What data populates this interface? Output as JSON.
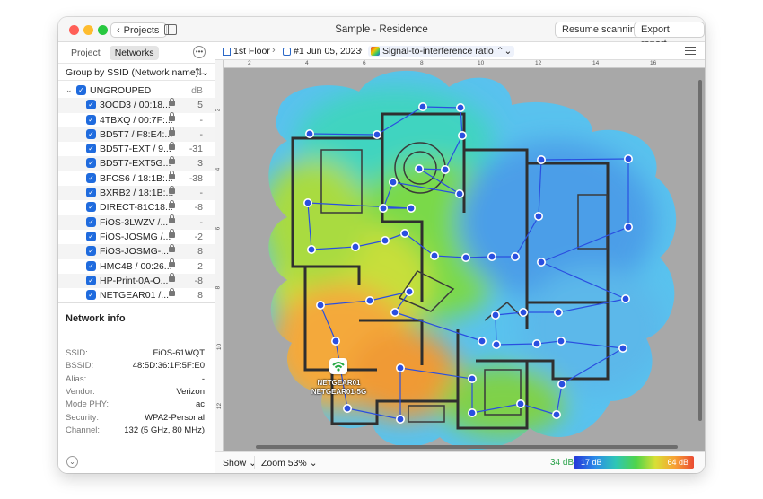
{
  "window": {
    "title": "Sample - Residence"
  },
  "toolbar": {
    "projects_label": "Projects",
    "resume_label": "Resume scanning",
    "export_label": "Export report..."
  },
  "sidebar": {
    "tabs": [
      "Project",
      "Networks"
    ],
    "active_tab": "Networks",
    "group_by_label": "Group by SSID (Network name)",
    "group": {
      "name": "UNGROUPED",
      "unit": "dB"
    },
    "networks": [
      {
        "name": "3OCD3 / 00:18...",
        "db": "5"
      },
      {
        "name": "4TBXQ / 00:7F:...",
        "db": "-"
      },
      {
        "name": "BD5T7 / F8:E4:...",
        "db": "-"
      },
      {
        "name": "BD5T7-EXT / 9...",
        "db": "-31"
      },
      {
        "name": "BD5T7-EXT5G...",
        "db": "3"
      },
      {
        "name": "BFCS6 / 18:1B:...",
        "db": "-38"
      },
      {
        "name": "BXRB2 / 18:1B:...",
        "db": "-"
      },
      {
        "name": "DIRECT-81C18...",
        "db": "-8"
      },
      {
        "name": "FiOS-3LWZV /...",
        "db": "-"
      },
      {
        "name": "FiOS-JOSMG /...",
        "db": "-2"
      },
      {
        "name": "FiOS-JOSMG-...",
        "db": "8"
      },
      {
        "name": "HMC4B / 00:26...",
        "db": "2"
      },
      {
        "name": "HP-Print-0A-O...",
        "db": "-8"
      },
      {
        "name": "NETGEAR01 /...",
        "db": "8"
      }
    ],
    "network_info": {
      "title": "Network info",
      "rows": [
        {
          "key": "SSID:",
          "value": "FiOS-61WQT"
        },
        {
          "key": "BSSID:",
          "value": "48:5D:36:1F:5F:E0"
        },
        {
          "key": "Alias:",
          "value": "-"
        },
        {
          "key": "Vendor:",
          "value": "Verizon"
        },
        {
          "key": "Mode PHY:",
          "value": "ac"
        },
        {
          "key": "Security:",
          "value": "WPA2-Personal"
        },
        {
          "key": "Channel:",
          "value": "132 (5 GHz, 80 MHz)"
        }
      ]
    }
  },
  "breadcrumb": {
    "floor": "1st Floor",
    "survey": "#1 Jun 05, 2023",
    "metric": "Signal-to-interference ratio"
  },
  "rulers": {
    "top": [
      "2",
      "4",
      "6",
      "8",
      "10",
      "12",
      "14",
      "16"
    ],
    "left": [
      "2",
      "4",
      "6",
      "8",
      "10",
      "12"
    ]
  },
  "access_point": {
    "label_line1": "NETGEAR01",
    "label_line2": "NETGEAR01-5G"
  },
  "statusbar": {
    "show_label": "Show",
    "zoom_label": "Zoom 53%",
    "min_label": "34 dB",
    "legend_low": "17 dB",
    "legend_high": "64 dB"
  },
  "colors": {
    "accent": "#1f6bde",
    "point": "#2a4fe0"
  },
  "survey_points": [
    [
      345,
      149
    ],
    [
      420,
      150
    ],
    [
      471,
      119
    ],
    [
      513,
      120
    ],
    [
      515,
      151
    ],
    [
      496,
      189
    ],
    [
      467,
      188
    ],
    [
      512,
      216
    ],
    [
      438,
      203
    ],
    [
      427,
      232
    ],
    [
      458,
      232
    ],
    [
      343,
      226
    ],
    [
      347,
      278
    ],
    [
      396,
      275
    ],
    [
      429,
      268
    ],
    [
      451,
      260
    ],
    [
      484,
      285
    ],
    [
      519,
      287
    ],
    [
      548,
      286
    ],
    [
      574,
      286
    ],
    [
      600,
      241
    ],
    [
      603,
      178
    ],
    [
      700,
      177
    ],
    [
      700,
      253
    ],
    [
      603,
      292
    ],
    [
      697,
      333
    ],
    [
      622,
      348
    ],
    [
      583,
      348
    ],
    [
      552,
      351
    ],
    [
      553,
      384
    ],
    [
      598,
      383
    ],
    [
      625,
      380
    ],
    [
      694,
      388
    ],
    [
      626,
      428
    ],
    [
      620,
      462
    ],
    [
      580,
      450
    ],
    [
      526,
      460
    ],
    [
      526,
      422
    ],
    [
      446,
      410
    ],
    [
      446,
      467
    ],
    [
      387,
      455
    ],
    [
      374,
      380
    ],
    [
      357,
      340
    ],
    [
      412,
      335
    ],
    [
      456,
      325
    ],
    [
      440,
      348
    ],
    [
      537,
      380
    ]
  ]
}
